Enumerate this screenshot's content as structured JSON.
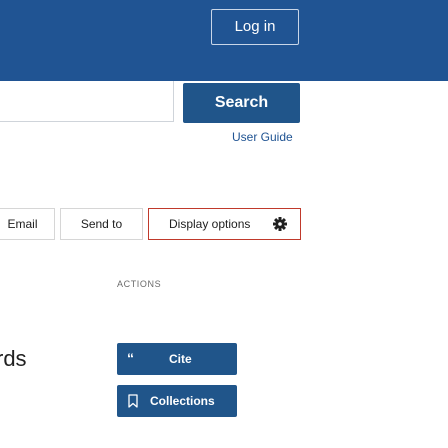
{
  "header": {
    "login_label": "Log in"
  },
  "search": {
    "value": "",
    "button_label": "Search",
    "user_guide_label": "User Guide"
  },
  "results_toolbar": {
    "email_label": "Email",
    "send_to_label": "Send to",
    "display_options_label": "Display options",
    "display_options_icon": "gear-icon"
  },
  "actions": {
    "heading": "ACTIONS",
    "cite_icon": "quote-icon",
    "cite_glyph": "“",
    "cite_label": "Cite",
    "collections_icon": "bookmark-icon",
    "collections_label": "Collections"
  },
  "results": {
    "heading_partial": "rds"
  },
  "colors": {
    "header_bg": "#205493",
    "primary_button": "#20558a",
    "link": "#205493",
    "active_border": "#c0392b"
  }
}
